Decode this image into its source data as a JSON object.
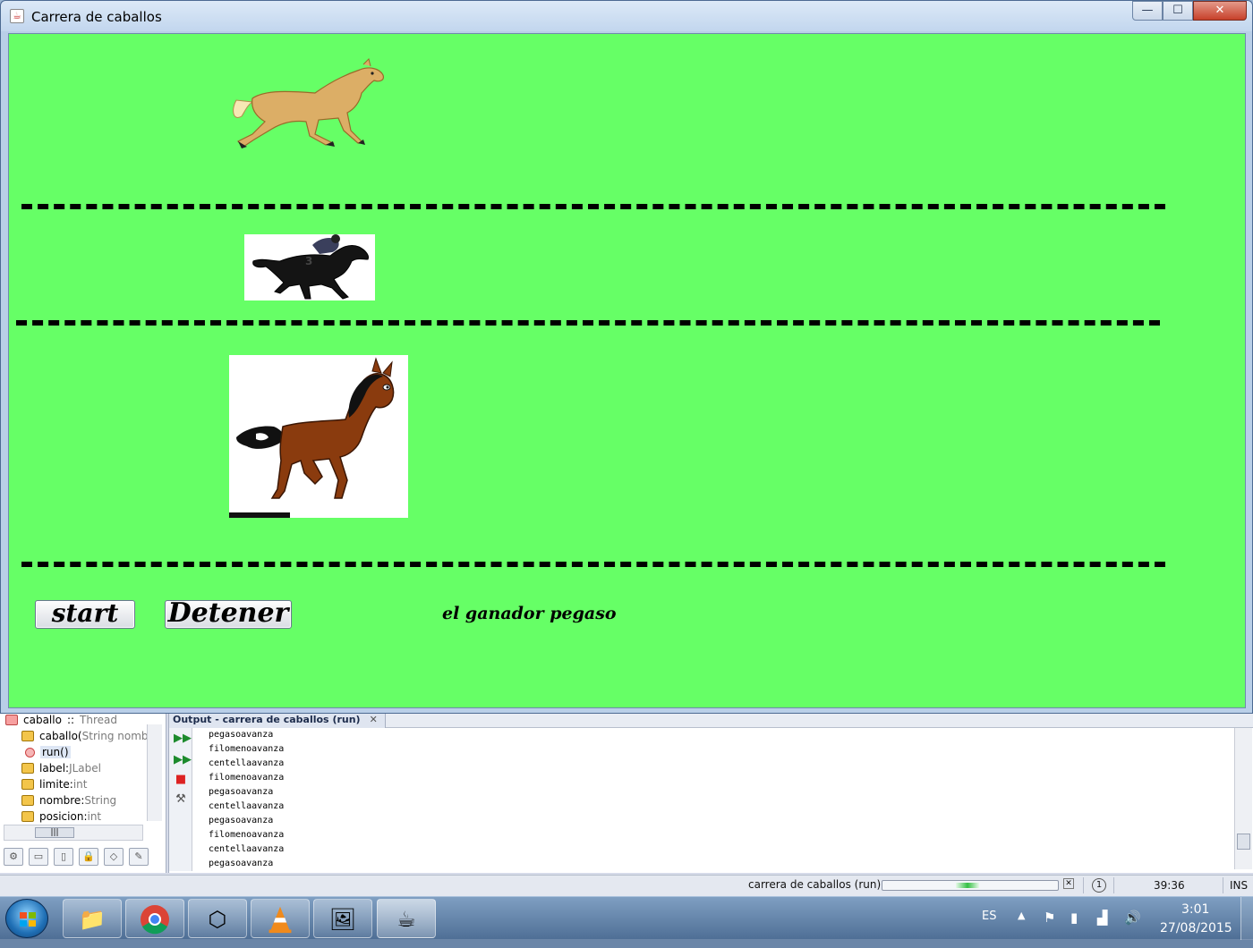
{
  "window": {
    "title": "Carrera de caballos",
    "controls": {
      "minimize": "—",
      "maximize": "☐",
      "close": "✕"
    }
  },
  "race": {
    "background": "#66ff66",
    "horses": [
      "pegaso",
      "filomeno",
      "centella"
    ],
    "start_label": "start",
    "stop_label": "Detener",
    "winner_text": "el ganador pegaso"
  },
  "navigator": {
    "title": "caballo",
    "title_sep": " :: ",
    "title_type": "Thread",
    "items": [
      {
        "name": "caballo(",
        "type": "String nomb"
      },
      {
        "name": "run()",
        "type": ""
      },
      {
        "name": "label",
        "sep": " : ",
        "type": "JLabel"
      },
      {
        "name": "limite",
        "sep": " : ",
        "type": "int"
      },
      {
        "name": "nombre",
        "sep": " : ",
        "type": "String"
      },
      {
        "name": "posicion",
        "sep": " : ",
        "type": "int"
      }
    ]
  },
  "output": {
    "tab_label": "Output - carrera de caballos (run)",
    "close": "✕",
    "lines": [
      "pegasoavanza",
      "filomenoavanza",
      "centellaavanza",
      "filomenoavanza",
      "pegasoavanza",
      "centellaavanza",
      "pegasoavanza",
      "filomenoavanza",
      "centellaavanza",
      "pegasoavanza"
    ]
  },
  "statusbar": {
    "task": "carrera de caballos (run)",
    "progress": 0.5,
    "position": "39:36",
    "mode": "INS"
  },
  "taskbar": {
    "apps": [
      "file-explorer",
      "chrome",
      "virtualbox",
      "vlc",
      "photo-viewer",
      "java"
    ],
    "language": "ES",
    "time": "3:01",
    "date": "27/08/2015"
  }
}
